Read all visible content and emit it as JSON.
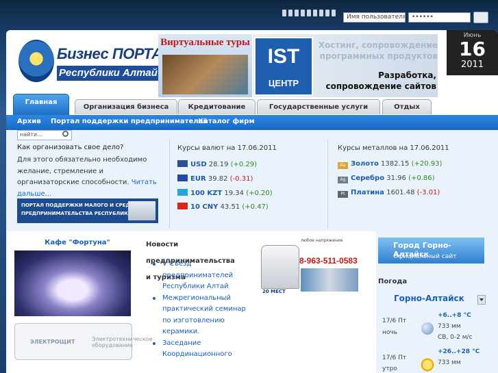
{
  "login": {
    "username_placeholder": "Имя пользователя (",
    "password_value": "••••••"
  },
  "header": {
    "logo_title": "Бизнес ПОРТАЛ",
    "logo_subtitle": "Республики Алтай",
    "banner_tours_title": "Виртуальные туры",
    "ist_logo_big": "IST",
    "ist_logo_small": "ЦЕНТР",
    "ist_ghost_text": "Хостинг, сопровождение программных продуктов",
    "ist_main_text": "Разработка, сопровождение сайтов",
    "date_month": "Июнь",
    "date_day": "16",
    "date_year": "2011"
  },
  "tabs": [
    "Главная",
    "Организация бизнеса",
    "Кредитование",
    "Государственные услуги",
    "Отдых"
  ],
  "subnav": [
    "Архив",
    "Портал поддержки предпринимателей",
    "Каталог фирм"
  ],
  "search": {
    "placeholder": "найти..."
  },
  "intro": {
    "title": "Как организовать свое дело?",
    "text": "Для этого обязательно необходимо желание, стремление и организаторские способности.",
    "link": "Читать дальше..."
  },
  "support_banner": {
    "line1": "ПОРТАЛ ПОДДЕРЖКИ МАЛОГО И СРЕДНЕГО",
    "line2": "ПРЕДПРИНИМАТЕЛЬСТВА РЕСПУБЛИКИ АЛТАЙ"
  },
  "currency": {
    "title": "Курсы валют на 17.06.2011",
    "rows": [
      {
        "code": "USD",
        "value": "28.19",
        "change": "(+0.29)",
        "trend": "pos",
        "flag_color": "#2b4f9a"
      },
      {
        "code": "EUR",
        "value": "39.82",
        "change": "(-0.31)",
        "trend": "neg",
        "flag_color": "#2349a4"
      },
      {
        "code": "100 KZT",
        "value": "19.34",
        "change": "(+0.20)",
        "trend": "pos",
        "flag_color": "#22a8d8"
      },
      {
        "code": "10 CNY",
        "value": "43.51",
        "change": "(+0.47)",
        "trend": "pos",
        "flag_color": "#d6261b"
      }
    ]
  },
  "metals": {
    "title": "Курсы металлов на 17.06.2011",
    "rows": [
      {
        "name": "Золото",
        "symbol": "Au",
        "value": "1382.15",
        "change": "(+20.93)",
        "trend": "pos",
        "chip_color": "#e0a43a"
      },
      {
        "name": "Серебро",
        "symbol": "Ag",
        "value": "31.96",
        "change": "(+0.86)",
        "trend": "pos",
        "chip_color": "#6f7d8c"
      },
      {
        "name": "Платина",
        "symbol": "Pt",
        "value": "1601.48",
        "change": "(-3.01)",
        "trend": "neg",
        "chip_color": "#5d6672"
      }
    ]
  },
  "cafe": {
    "title": "Кафе \"Фортуна\""
  },
  "elektro": {
    "name": "ЭЛЕКТРОЩИТ",
    "caption": "Электротехническое оборудование"
  },
  "news": {
    "title": "Новости предпринимательства и туризма",
    "items": [
      "V Съезд предпринимателей Республики Алтай",
      "Межрегиональный практический семинар по изготовлению керамики.",
      "Заседание Координационного"
    ]
  },
  "van_ad": {
    "small_text": "любое напряжение",
    "phone": "8-963-511-0583",
    "seats": "20 МЕСТ"
  },
  "city_banner": {
    "title": "Город Горно-Алтайск",
    "subtitle": "Официальный сайт"
  },
  "weather": {
    "title": "Погода",
    "city": "Горно-Алтайск",
    "entries": [
      {
        "date": "17/6 Пт",
        "part": "ночь",
        "temp": "+6..+8 °С",
        "pressure": "733 мм",
        "wind": "СВ, 0-2 м/с"
      },
      {
        "date": "17/6 Пт",
        "part": "утро",
        "temp": "+26..+28 °С",
        "pressure": "733 мм",
        "wind": ""
      }
    ]
  }
}
